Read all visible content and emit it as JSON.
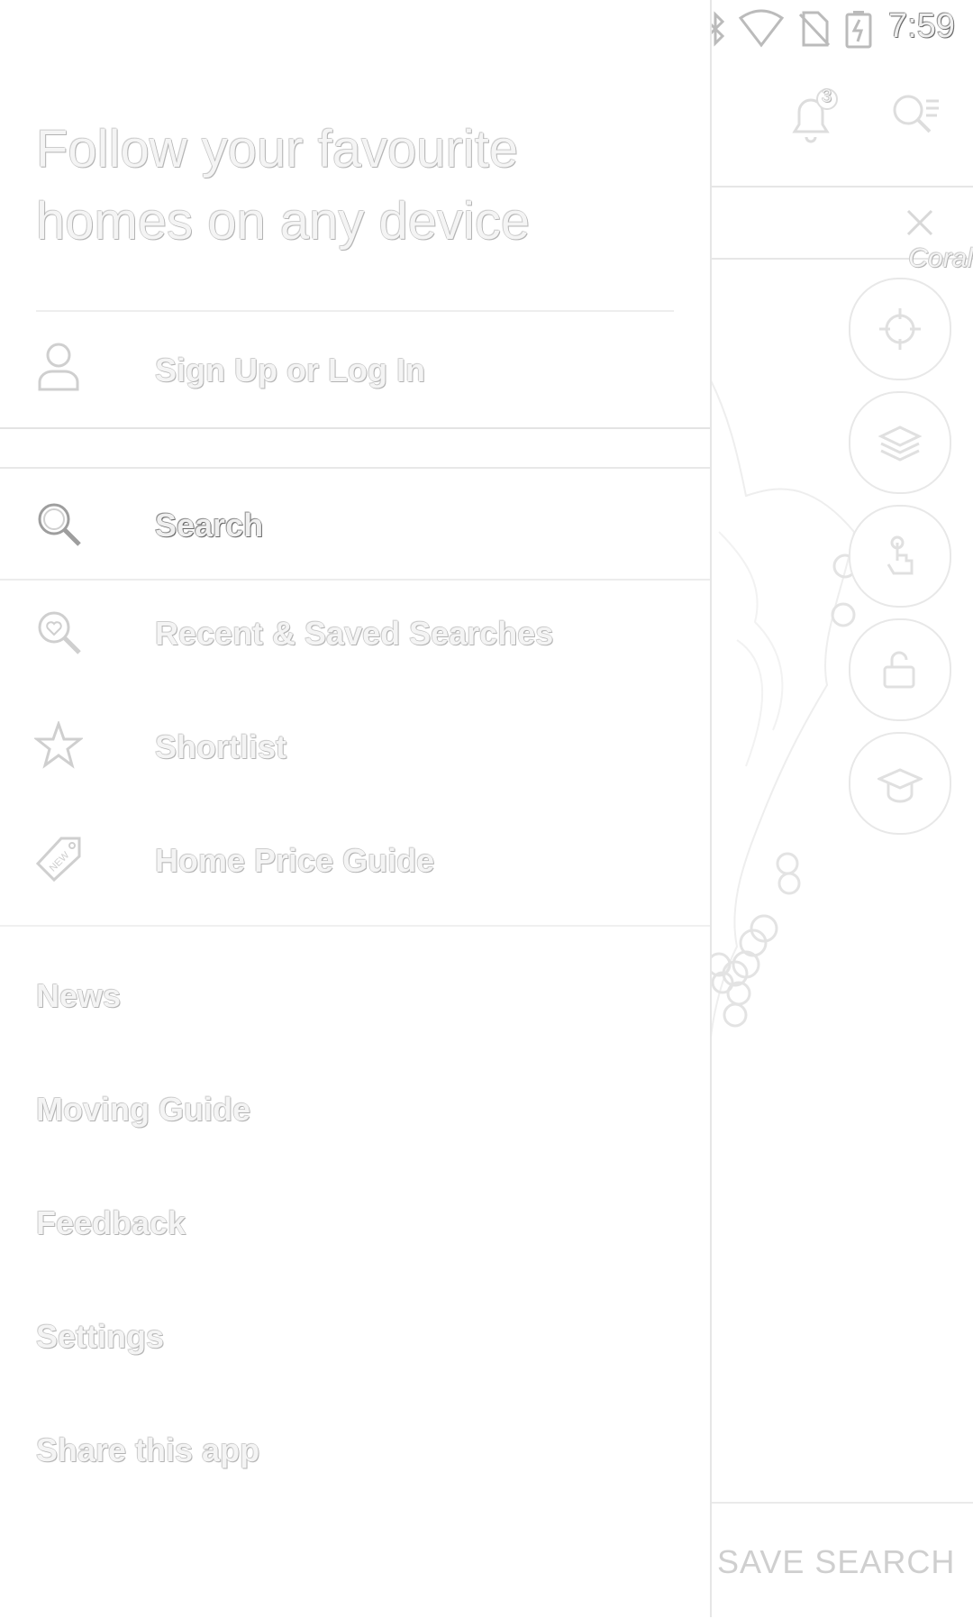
{
  "status_bar": {
    "time": "7:59",
    "left_icons": [
      "facebook-icon",
      "facebook-icon",
      "facebook-icon",
      "facebook-icon",
      "facebook-icon",
      "facebook-icon",
      "leaf-icon",
      "facebook-icon",
      "circle-icon",
      "lock-icon",
      "android-icon"
    ],
    "right_icons": [
      "bluetooth-icon",
      "wifi-icon",
      "no-sim-icon",
      "battery-charging-icon"
    ]
  },
  "drawer": {
    "headline": "Follow your favourite homes on any device",
    "sign_in_label": "Sign Up or Log In",
    "menu": [
      {
        "label": "Search",
        "icon": "search-icon",
        "active": true
      },
      {
        "label": "Recent & Saved Searches",
        "icon": "saved-search-icon"
      },
      {
        "label": "Shortlist",
        "icon": "star-icon"
      },
      {
        "label": "Home Price Guide",
        "icon": "new-tag-icon"
      }
    ],
    "links": [
      "News",
      "Moving Guide",
      "Feedback",
      "Settings",
      "Share this app"
    ]
  },
  "map_panel": {
    "notification_count": "3",
    "partial_place_label": "Coral",
    "save_search_label": "SAVE SEARCH"
  }
}
